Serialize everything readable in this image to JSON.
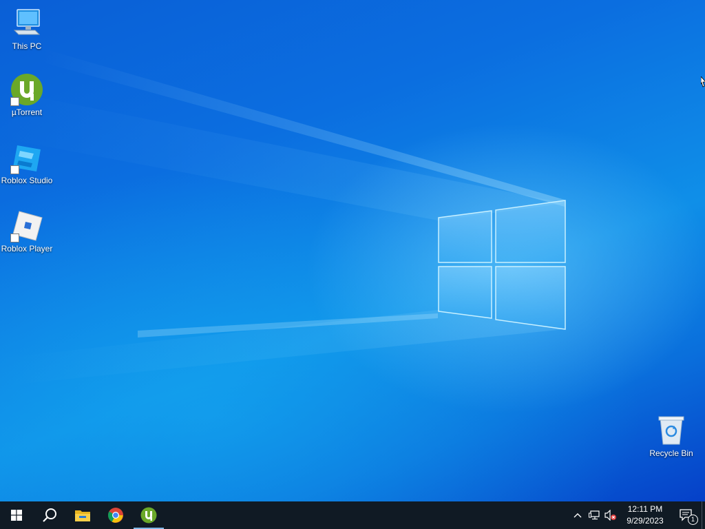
{
  "desktop": {
    "icons": [
      {
        "label": "This PC",
        "icon": "this-pc-icon"
      },
      {
        "label": "µTorrent",
        "icon": "utorrent-icon"
      },
      {
        "label": "Roblox Studio",
        "icon": "roblox-studio-icon"
      },
      {
        "label": "Roblox Player",
        "icon": "roblox-player-icon"
      },
      {
        "label": "Recycle Bin",
        "icon": "recycle-bin-icon"
      }
    ]
  },
  "taskbar": {
    "start": "windows-start-icon",
    "search": "search-icon",
    "pinned": [
      "file-explorer-icon",
      "chrome-icon",
      "utorrent-icon"
    ],
    "tray": {
      "icons": [
        "chevron-up-icon",
        "network-icon",
        "volume-muted-icon"
      ],
      "time": "12:11 PM",
      "date": "9/29/2023",
      "notification_count": "1"
    }
  },
  "colors": {
    "taskbar_bg": "#101a24",
    "desktop_accent": "#0b6ee0",
    "utorrent_green": "#6aa829"
  }
}
